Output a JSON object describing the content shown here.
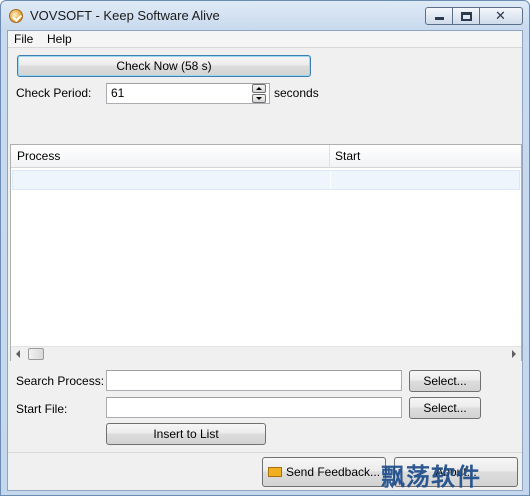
{
  "window": {
    "title": "VOVSOFT - Keep Software Alive",
    "icon": "app-logo-icon"
  },
  "menu": {
    "items": [
      {
        "label": "File"
      },
      {
        "label": "Help"
      }
    ]
  },
  "check": {
    "button_label": "Check Now (58 s)",
    "period_label": "Check Period:",
    "period_value": "61",
    "period_unit": "seconds"
  },
  "process_list": {
    "columns": [
      "Process",
      "Start"
    ],
    "rows": []
  },
  "search": {
    "process_label": "Search Process:",
    "process_value": "",
    "select_label": "Select...",
    "file_label": "Start File:",
    "file_value": "",
    "file_select_label": "Select...",
    "insert_label": "Insert to List"
  },
  "footer": {
    "feedback_label": "Send Feedback...",
    "about_label": "About..."
  },
  "watermark": {
    "text": "飘荡软件"
  }
}
